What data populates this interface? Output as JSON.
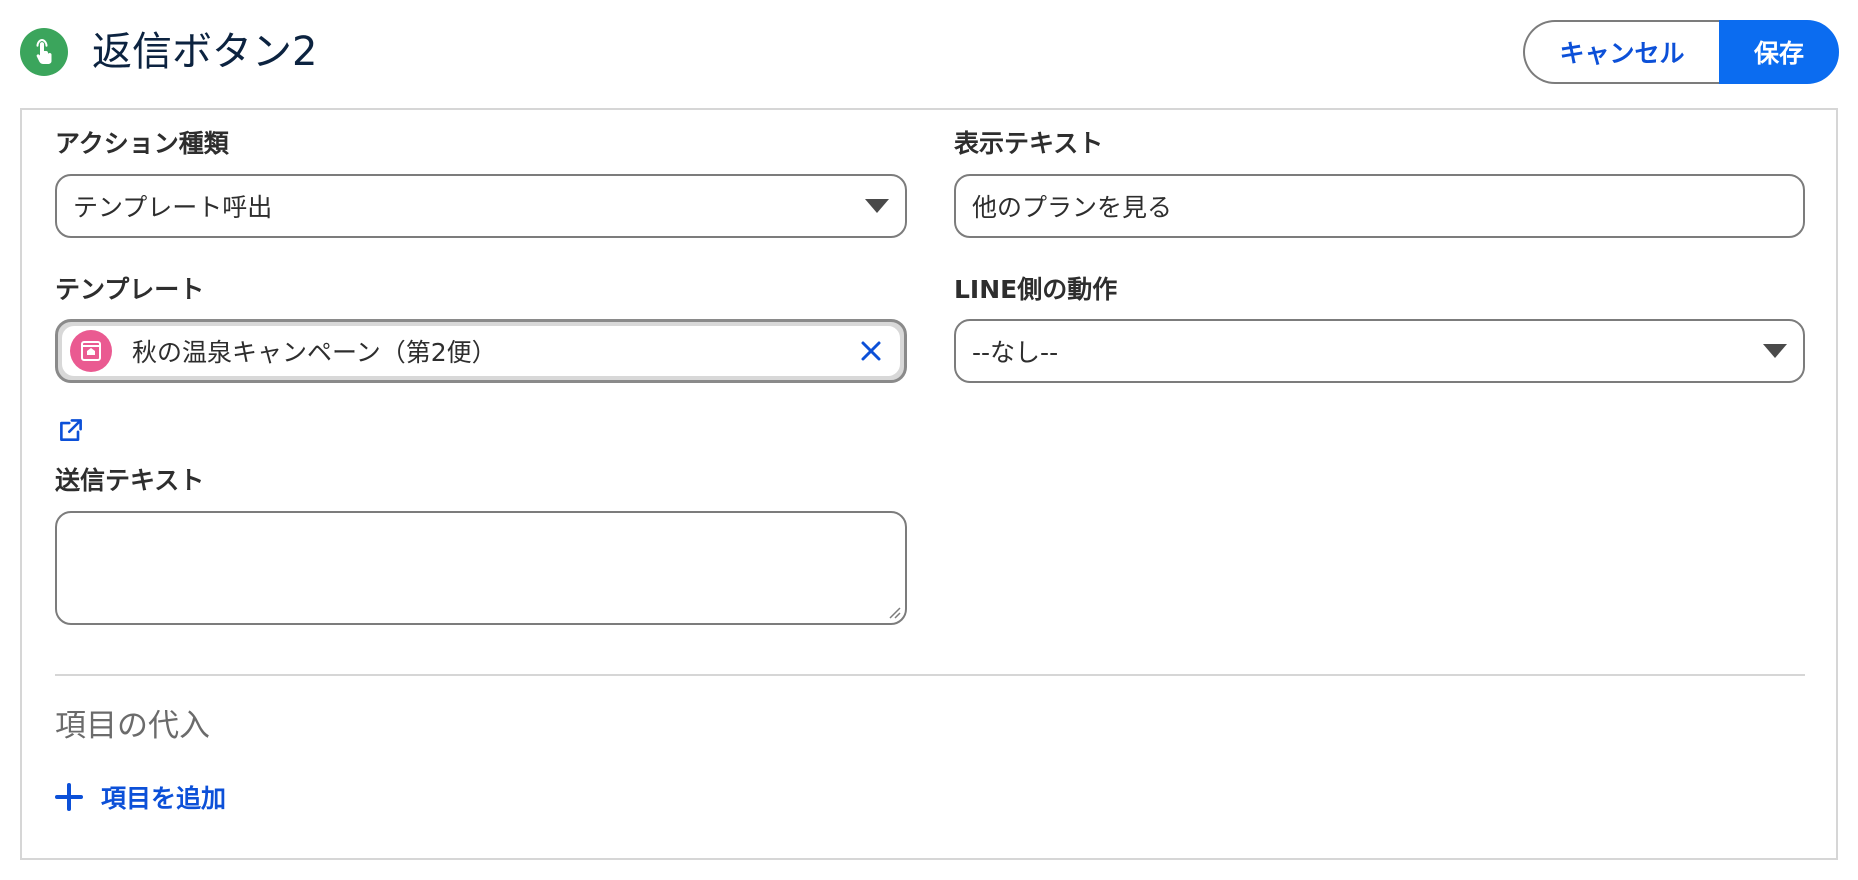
{
  "header": {
    "title": "返信ボタン2",
    "title_icon": "touch-gesture-icon",
    "cancel_label": "キャンセル",
    "save_label": "保存",
    "colors": {
      "title_icon_bg": "#3ba55c",
      "primary_blue": "#0b6cf0",
      "link_blue": "#0c50d8"
    }
  },
  "form": {
    "action_type": {
      "label": "アクション種類",
      "value": "テンプレート呼出"
    },
    "display_text": {
      "label": "表示テキスト",
      "value": "他のプランを見る"
    },
    "template": {
      "label": "テンプレート",
      "value": "秋の温泉キャンペーン（第2便）",
      "record_icon": "template-record-icon",
      "record_icon_color": "#ea5a91",
      "clear_icon": "close-icon",
      "open_icon": "external-link-icon"
    },
    "line_behavior": {
      "label": "LINE側の動作",
      "value": "--なし--"
    },
    "send_text": {
      "label": "送信テキスト",
      "value": ""
    }
  },
  "field_assignment": {
    "title": "項目の代入",
    "add_label": "項目を追加",
    "add_icon": "plus-icon"
  }
}
